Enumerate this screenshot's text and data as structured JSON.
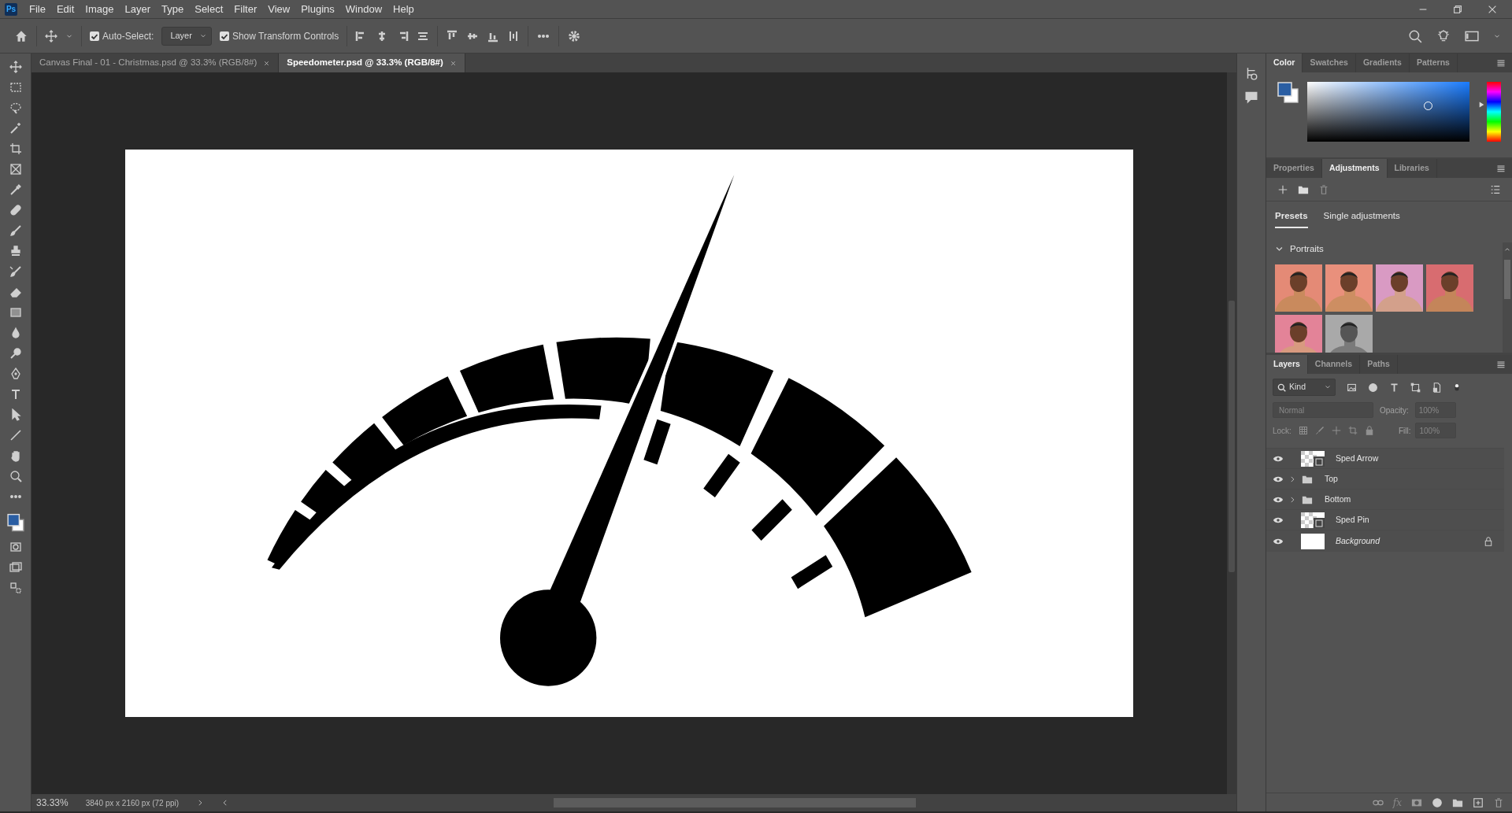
{
  "app": {
    "logo": "Ps"
  },
  "menu": [
    "File",
    "Edit",
    "Image",
    "Layer",
    "Type",
    "Select",
    "Filter",
    "View",
    "Plugins",
    "Window",
    "Help"
  ],
  "options_bar": {
    "auto_select": {
      "label": "Auto-Select:",
      "checked": true
    },
    "target": "Layer",
    "transform_controls": {
      "label": "Show Transform Controls",
      "checked": true
    }
  },
  "document_tabs": [
    {
      "title": "Canvas Final - 01 - Christmas.psd @ 33.3% (RGB/8#)",
      "selected": false
    },
    {
      "title": "Speedometer.psd @ 33.3% (RGB/8#)",
      "selected": true
    }
  ],
  "color_panel": {
    "hue": {
      "level": 0.62
    },
    "tabs": [
      {
        "label": "Color",
        "selected": true
      },
      {
        "label": "Swatches",
        "selected": false
      },
      {
        "label": "Gradients",
        "selected": false
      },
      {
        "label": "Patterns",
        "selected": false
      }
    ]
  },
  "adjustments_panel": {
    "tabs": [
      {
        "label": "Properties",
        "selected": false
      },
      {
        "label": "Adjustments",
        "selected": true
      },
      {
        "label": "Libraries",
        "selected": false
      }
    ],
    "subtabs": [
      {
        "label": "Presets",
        "selected": true
      },
      {
        "label": "Single adjustments",
        "selected": false
      }
    ],
    "group": {
      "label": "Portraits",
      "expanded": true
    }
  },
  "layers_panel": {
    "tabs": [
      {
        "label": "Layers",
        "selected": true
      },
      {
        "label": "Channels",
        "selected": false
      },
      {
        "label": "Paths",
        "selected": false
      }
    ],
    "filter": "Kind",
    "blend_mode": "Normal",
    "opacity_label": "Opacity:",
    "opacity": "100%",
    "lock_label": "Lock:",
    "fill_label": "Fill:",
    "fill": "100%",
    "disabled": true,
    "layers": [
      {
        "name": "Sped Arrow",
        "kind": "smart",
        "visible": true,
        "locked": false
      },
      {
        "name": "Top",
        "kind": "group",
        "visible": true,
        "locked": false
      },
      {
        "name": "Bottom",
        "kind": "group",
        "visible": true,
        "locked": false
      },
      {
        "name": "Sped Pin",
        "kind": "smart",
        "visible": true,
        "locked": false
      },
      {
        "name": "Background",
        "kind": "background",
        "visible": true,
        "locked": true
      }
    ],
    "fx": "fx"
  },
  "status_bar": {
    "zoom": "33.33%",
    "document_info": "3840 px x 2160 px (72 ppi)"
  }
}
